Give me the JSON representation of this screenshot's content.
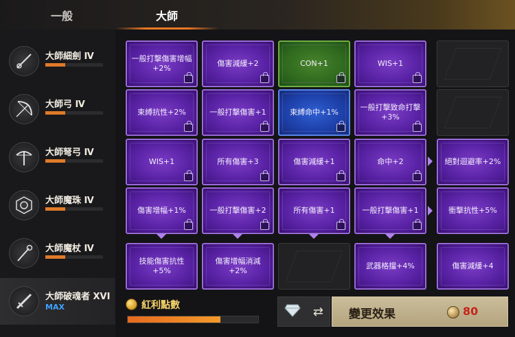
{
  "tabs": [
    {
      "label": "一般",
      "active": false
    },
    {
      "label": "大師",
      "active": true
    }
  ],
  "sidebar": {
    "items": [
      {
        "label": "大師細劍 Ⅳ",
        "icon": "rapier-icon",
        "progress": 0.35
      },
      {
        "label": "大師弓 Ⅳ",
        "icon": "bow-icon",
        "progress": 0.35
      },
      {
        "label": "大師弩弓 Ⅳ",
        "icon": "crossbow-icon",
        "progress": 0.35
      },
      {
        "label": "大師魔珠 Ⅳ",
        "icon": "orb-icon",
        "progress": 0.35
      },
      {
        "label": "大師魔杖 Ⅳ",
        "icon": "staff-icon",
        "progress": 0.35
      },
      {
        "label": "大師破魂者 XVI",
        "icon": "soulbreaker-icon",
        "max_label": "MAX",
        "active": true
      }
    ]
  },
  "grid": {
    "rows": [
      [
        {
          "label": "一般打擊傷害增幅+2%",
          "color": "purple",
          "locked": true
        },
        {
          "label": "傷害減緩+2",
          "color": "purple",
          "locked": true
        },
        {
          "label": "CON+1",
          "color": "green",
          "locked": true
        },
        {
          "label": "WIS+1",
          "color": "purple",
          "locked": true
        },
        {
          "label": "",
          "color": "empty",
          "locked": false
        }
      ],
      [
        {
          "label": "束縛抗性+2%",
          "color": "purple",
          "locked": true
        },
        {
          "label": "一般打擊傷害+1",
          "color": "purple",
          "locked": true
        },
        {
          "label": "束縛命中+1%",
          "color": "blue",
          "locked": true
        },
        {
          "label": "一般打擊致命打擊+3%",
          "color": "purple",
          "locked": true
        },
        {
          "label": "",
          "color": "empty",
          "locked": false
        }
      ],
      [
        {
          "label": "WIS+1",
          "color": "purple",
          "locked": true
        },
        {
          "label": "所有傷害+3",
          "color": "purple",
          "locked": true
        },
        {
          "label": "傷害減緩+1",
          "color": "purple",
          "locked": true
        },
        {
          "label": "命中+2",
          "color": "purple",
          "locked": true
        },
        {
          "label": "絕對迴避率+2%",
          "color": "purple",
          "locked": false
        }
      ],
      [
        {
          "label": "傷害增幅+1%",
          "color": "purple",
          "locked": true
        },
        {
          "label": "一般打擊傷害+2",
          "color": "purple",
          "locked": true
        },
        {
          "label": "所有傷害+1",
          "color": "purple",
          "locked": true
        },
        {
          "label": "一般打擊傷害+1",
          "color": "purple",
          "locked": true
        },
        {
          "label": "衝擊抗性+5%",
          "color": "purple",
          "locked": false
        }
      ],
      [
        {
          "label": "技能傷害抗性+5%",
          "color": "purple",
          "locked": false
        },
        {
          "label": "傷害增幅消減+2%",
          "color": "purple",
          "locked": false
        },
        {
          "label": "",
          "color": "empty",
          "locked": false
        },
        {
          "label": "武器格擋+4%",
          "color": "purple",
          "locked": false
        },
        {
          "label": "傷害減緩+4",
          "color": "purple",
          "locked": false
        }
      ]
    ]
  },
  "bonus": {
    "label": "紅利點數",
    "progress": 0.71
  },
  "change_button": {
    "label": "變更效果",
    "cost": "80"
  },
  "colors": {
    "accent": "#f07a24",
    "purple": "#5a23a6",
    "green": "#2f6a1e",
    "blue": "#1d3fa8",
    "cost": "#c4251c"
  }
}
